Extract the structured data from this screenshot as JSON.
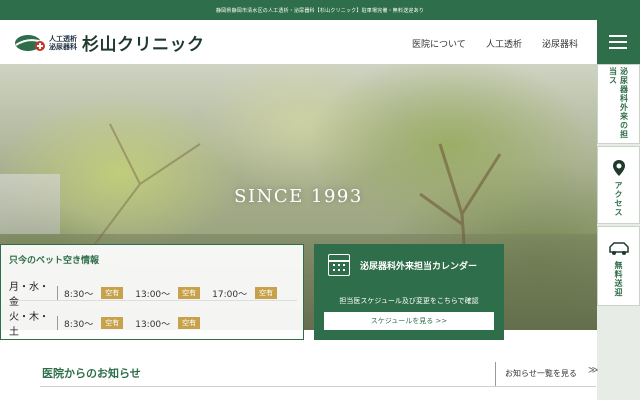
{
  "topbar": {
    "text": "静岡県静岡市清水区の人工透析・泌尿器科【杉山クリニック】駐車場完備・無料送迎あり"
  },
  "logo": {
    "line1": "人工透析",
    "line2": "泌尿器科",
    "name": "杉山クリニック"
  },
  "nav": {
    "items": [
      {
        "label": "医院について"
      },
      {
        "label": "人工透析"
      },
      {
        "label": "泌尿器科"
      }
    ]
  },
  "hero": {
    "tagline": "SINCE 1993"
  },
  "side": {
    "schedule": "泌尿器科外来の担当ス",
    "access": "アクセス",
    "shuttle": "無料送迎"
  },
  "bed": {
    "title": "只今のベット空き情報",
    "rows": [
      {
        "day": "月・水・金",
        "slots": [
          {
            "time": "8:30〜",
            "status": "空有"
          },
          {
            "time": "13:00〜",
            "status": "空有"
          },
          {
            "time": "17:00〜",
            "status": "空有"
          }
        ]
      },
      {
        "day": "火・木・土",
        "slots": [
          {
            "time": "8:30〜",
            "status": "空有"
          },
          {
            "time": "13:00〜",
            "status": "空有"
          }
        ]
      }
    ]
  },
  "calendar": {
    "title": "泌尿器科外来担当カレンダー",
    "subtitle": "担当医スケジュール及び変更をこちらで確認",
    "button": "スケジュールを見る >>"
  },
  "news": {
    "title": "医院からのお知らせ",
    "link": "お知らせ一覧を見る",
    "arrow": "≫"
  },
  "colors": {
    "brand": "#2f6e4a",
    "badge": "#c7a24a"
  }
}
